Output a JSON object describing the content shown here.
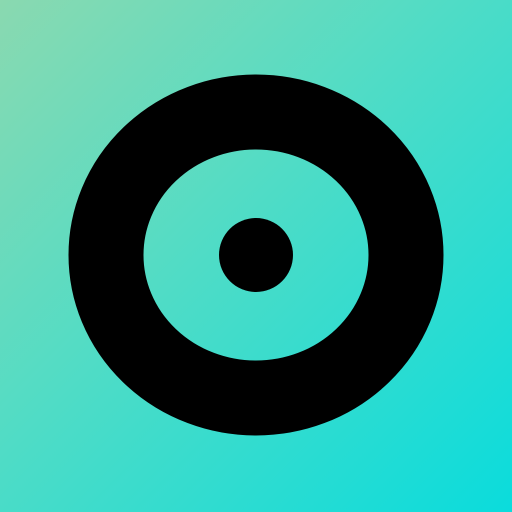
{
  "icon": {
    "name": "target-ring-logo-icon",
    "colors": {
      "gradient_start": "#8ad9b0",
      "gradient_mid": "#4fdcc6",
      "gradient_end": "#0adcdc",
      "mark": "#000000"
    }
  }
}
